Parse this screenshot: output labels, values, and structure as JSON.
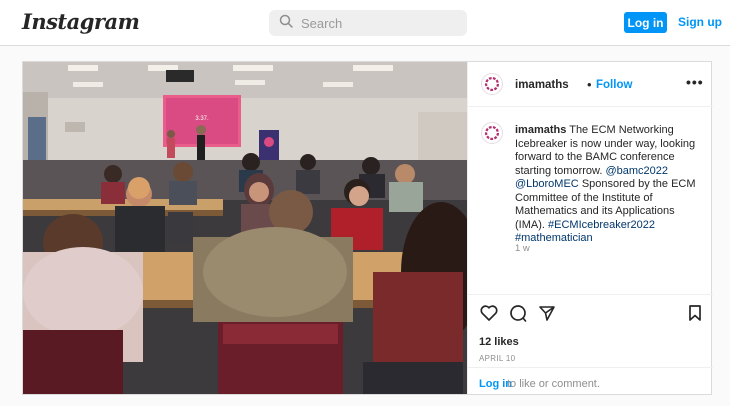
{
  "header": {
    "logo": "Instagram",
    "search_placeholder": "Search",
    "login_label": "Log in",
    "signup_label": "Sign up"
  },
  "post": {
    "username": "imamaths",
    "separator": "•",
    "follow_label": "Follow",
    "more_label": "•••",
    "projector_text": "3.37.",
    "caption": {
      "username": "imamaths",
      "line1": "The ECM Networking Icebreaker is now under way, looking forward to the BAMC conference starting tomorrow.",
      "mention1": "@bamc2022",
      "mention2": "@LboroMEC",
      "line2": "Sponsored by the ECM Committee of the Institute of Mathematics and its Applications (IMA).",
      "hashtag1": "#ECMIcebreaker2022",
      "hashtag2": "#mathematician"
    },
    "time_ago": "1 w",
    "likes": "12 likes",
    "date": "APRIL 10",
    "comment": {
      "login_label": "Log in",
      "rest": "to like or comment."
    }
  },
  "icons": [
    "search-icon",
    "heart-icon",
    "comment-icon",
    "share-icon",
    "bookmark-icon",
    "more-icon",
    "avatar"
  ],
  "colors": {
    "accent": "#0095f6",
    "text": "#262626",
    "muted": "#8e8e8e",
    "avatar": "#b5306f"
  }
}
